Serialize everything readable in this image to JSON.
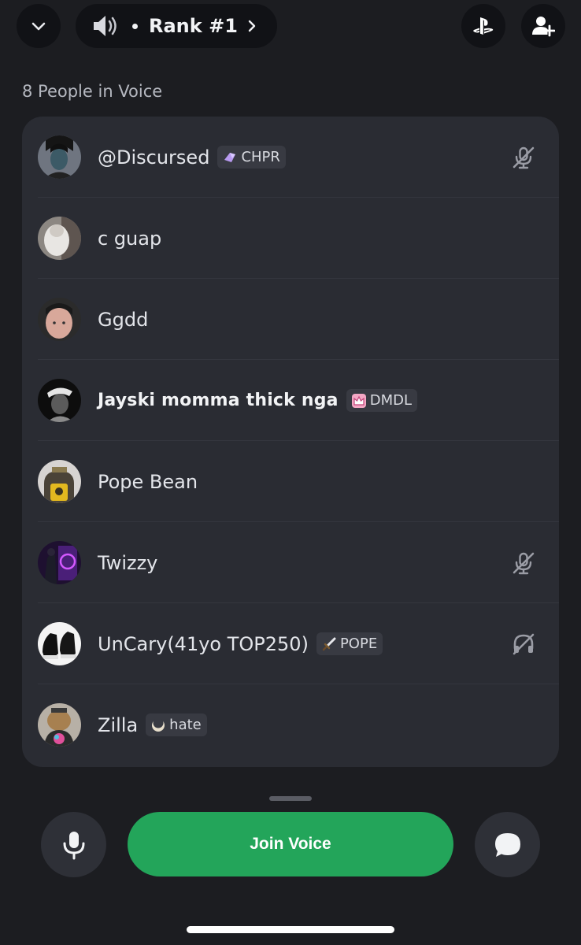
{
  "header": {
    "channel_name": "Rank #1",
    "icons": {
      "collapse": "chevron-down-icon",
      "channel_type": "speaker-icon",
      "open": "chevron-right-icon",
      "activity": "playstation-icon",
      "invite": "add-friend-icon"
    }
  },
  "voice": {
    "people_label": "8 People in Voice",
    "members": [
      {
        "name": "@Discursed",
        "tag": "CHPR",
        "tag_icon": "gem-icon",
        "status_icon": "muted-mic-icon"
      },
      {
        "name": "c guap",
        "tag": "",
        "tag_icon": "",
        "status_icon": ""
      },
      {
        "name": "Ggdd",
        "tag": "",
        "tag_icon": "",
        "status_icon": ""
      },
      {
        "name": "Jayski momma thick nga",
        "tag": "DMDL",
        "tag_icon": "crown-icon",
        "status_icon": ""
      },
      {
        "name": "Pope Bean",
        "tag": "",
        "tag_icon": "",
        "status_icon": ""
      },
      {
        "name": "Twizzy",
        "tag": "",
        "tag_icon": "",
        "status_icon": "muted-mic-icon"
      },
      {
        "name": "UnCary(41yo TOP250)",
        "tag": "POPE",
        "tag_icon": "sword-icon",
        "status_icon": "deafened-icon"
      },
      {
        "name": "Zilla",
        "tag": "hate",
        "tag_icon": "moon-icon",
        "status_icon": ""
      }
    ]
  },
  "bottom": {
    "join_label": "Join Voice",
    "icons": {
      "mic": "microphone-icon",
      "chat": "chat-bubble-icon"
    }
  },
  "colors": {
    "background": "#1c1d21",
    "card": "#2a2c33",
    "join_button": "#23a55a"
  }
}
